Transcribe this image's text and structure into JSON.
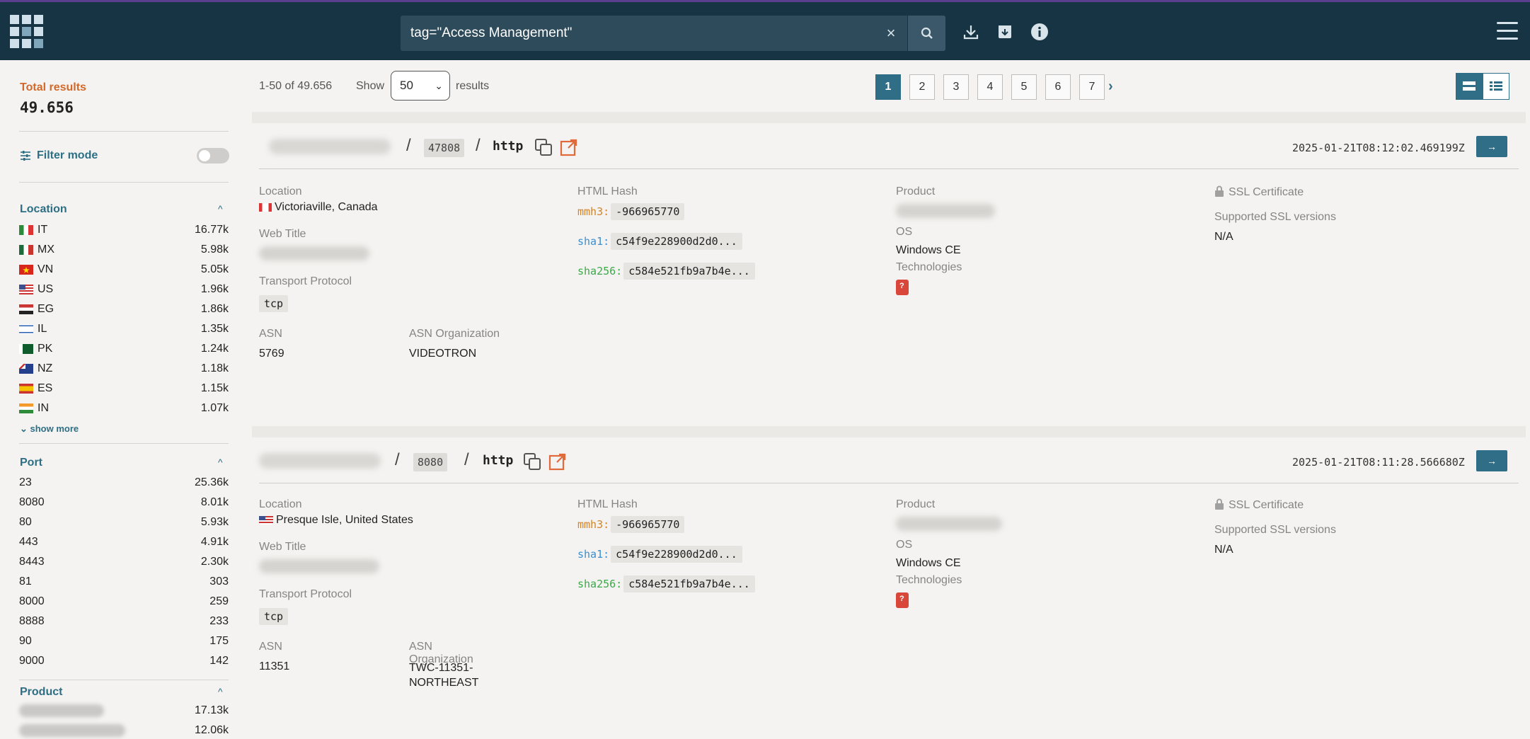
{
  "header": {
    "search_value": "tag=\"Access Management\"",
    "icons": [
      "logo-icon",
      "close-icon",
      "search-icon",
      "download-icon",
      "archive-icon",
      "info-icon",
      "menu-icon"
    ]
  },
  "sidebar": {
    "total_label": "Total results",
    "total_value": "49.656",
    "filter_mode_label": "Filter mode",
    "location": {
      "title": "Location",
      "items": [
        {
          "label": "IT",
          "count": "16.77k"
        },
        {
          "label": "MX",
          "count": "5.98k"
        },
        {
          "label": "VN",
          "count": "5.05k"
        },
        {
          "label": "US",
          "count": "1.96k"
        },
        {
          "label": "EG",
          "count": "1.86k"
        },
        {
          "label": "IL",
          "count": "1.35k"
        },
        {
          "label": "PK",
          "count": "1.24k"
        },
        {
          "label": "NZ",
          "count": "1.18k"
        },
        {
          "label": "ES",
          "count": "1.15k"
        },
        {
          "label": "IN",
          "count": "1.07k"
        }
      ],
      "show_more": "show more"
    },
    "port": {
      "title": "Port",
      "items": [
        {
          "label": "23",
          "count": "25.36k"
        },
        {
          "label": "8080",
          "count": "8.01k"
        },
        {
          "label": "80",
          "count": "5.93k"
        },
        {
          "label": "443",
          "count": "4.91k"
        },
        {
          "label": "8443",
          "count": "2.30k"
        },
        {
          "label": "81",
          "count": "303"
        },
        {
          "label": "8000",
          "count": "259"
        },
        {
          "label": "8888",
          "count": "233"
        },
        {
          "label": "90",
          "count": "175"
        },
        {
          "label": "9000",
          "count": "142"
        }
      ]
    },
    "product": {
      "title": "Product",
      "items": [
        {
          "count": "17.13k"
        },
        {
          "count": "12.06k"
        }
      ]
    }
  },
  "toolbar": {
    "range": "1-50 of 49.656",
    "show_label": "Show",
    "per_page": "50",
    "results_label": "results",
    "pages": [
      "1",
      "2",
      "3",
      "4",
      "5",
      "6",
      "7"
    ],
    "next": "›"
  },
  "results": [
    {
      "port": "47808",
      "protocol": "http",
      "timestamp": "2025-01-21T08:12:02.469199Z",
      "location_label": "Location",
      "location": "Victoriaville, Canada",
      "web_title_label": "Web Title",
      "transport_label": "Transport Protocol",
      "transport": "tcp",
      "asn_label": "ASN",
      "asn": "5769",
      "asn_org_label": "ASN Organization",
      "asn_org": "VIDEOTRON",
      "html_hash_label": "HTML Hash",
      "mmh3_label": "mmh3:",
      "mmh3": "-966965770",
      "sha1_label": "sha1:",
      "sha1": "c54f9e228900d2d0...",
      "sha256_label": "sha256:",
      "sha256": "c584e521fb9a7b4e...",
      "product_label": "Product",
      "os_label": "OS",
      "os": "Windows CE",
      "technologies_label": "Technologies",
      "ssl_label": "SSL Certificate",
      "ssl_versions_label": "Supported SSL versions",
      "ssl_versions": "N/A"
    },
    {
      "port": "8080",
      "protocol": "http",
      "timestamp": "2025-01-21T08:11:28.566680Z",
      "location_label": "Location",
      "location": "Presque Isle, United States",
      "web_title_label": "Web Title",
      "transport_label": "Transport Protocol",
      "transport": "tcp",
      "asn_label": "ASN",
      "asn": "11351",
      "asn_org_label": "ASN Organization",
      "asn_org": "TWC-11351-NORTHEAST",
      "html_hash_label": "HTML Hash",
      "mmh3_label": "mmh3:",
      "mmh3": "-966965770",
      "sha1_label": "sha1:",
      "sha1": "c54f9e228900d2d0...",
      "sha256_label": "sha256:",
      "sha256": "c584e521fb9a7b4e...",
      "product_label": "Product",
      "os_label": "OS",
      "os": "Windows CE",
      "technologies_label": "Technologies",
      "ssl_label": "SSL Certificate",
      "ssl_versions_label": "Supported SSL versions",
      "ssl_versions": "N/A"
    }
  ],
  "colors": {
    "header_bg": "#173444",
    "accent": "#2f6e86",
    "total_label": "#d2692a",
    "mmh3": "#d2852a",
    "sha1": "#3d8fcf",
    "sha256": "#3da84a"
  }
}
